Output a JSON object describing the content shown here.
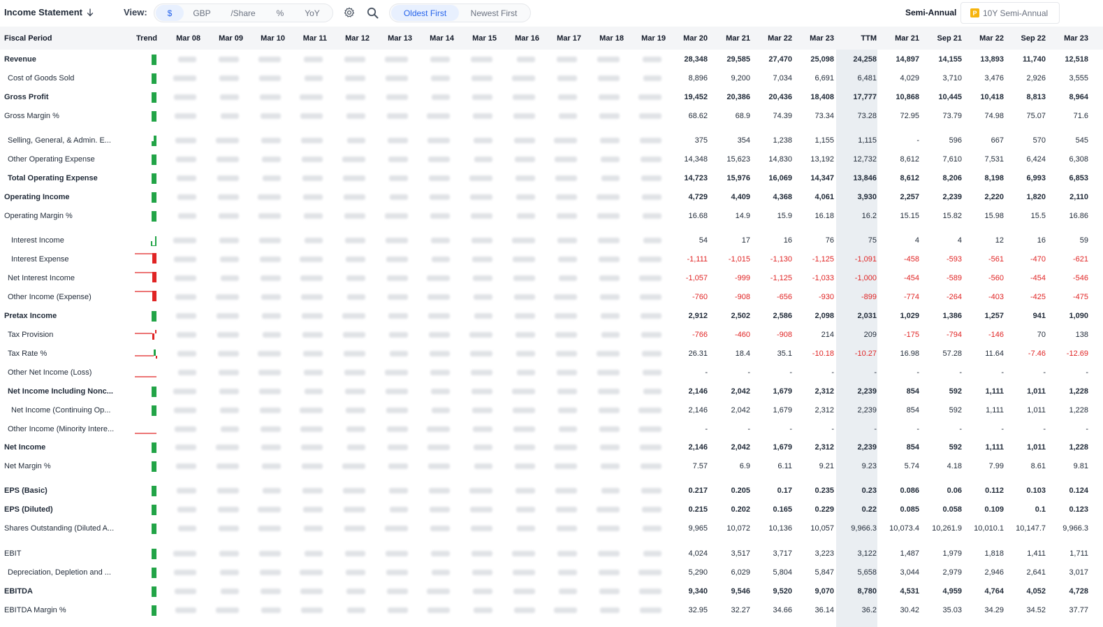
{
  "toolbar": {
    "title": "Income Statement",
    "view_label": "View:",
    "view_options": [
      "$",
      "GBP",
      "/Share",
      "%",
      "YoY"
    ],
    "order_options": [
      "Oldest First",
      "Newest First"
    ],
    "period_label": "Semi-Annual",
    "period_button": "10Y Semi-Annual",
    "period_badge": "P",
    "icons": [
      "settings-gear-icon",
      "search-icon",
      "sort-arrow-down-icon"
    ]
  },
  "table": {
    "label_header": "Fiscal Period",
    "trend_header": "Trend",
    "hidden_columns": [
      "Mar 08",
      "Mar 09",
      "Mar 10",
      "Mar 11",
      "Mar 12",
      "Mar 13",
      "Mar 14",
      "Mar 15",
      "Mar 16",
      "Mar 17",
      "Mar 18",
      "Mar 19"
    ],
    "visible_columns": [
      "Mar 20",
      "Mar 21",
      "Mar 22",
      "Mar 23",
      "TTM",
      "Mar 21",
      "Sep 21",
      "Mar 22",
      "Sep 22",
      "Mar 23"
    ],
    "colors": {
      "positive_trend": "#22a447",
      "negative_trend": "#e02424",
      "negative_value": "#e02424",
      "ttm_band": "#eaeef2"
    },
    "rows": [
      {
        "label": "Revenue",
        "bold": true,
        "indent": 0,
        "trend": "positive",
        "values": [
          "28,348",
          "29,585",
          "27,470",
          "25,098",
          "24,258",
          "14,897",
          "14,155",
          "13,893",
          "11,740",
          "12,518"
        ]
      },
      {
        "label": "Cost of Goods Sold",
        "bold": false,
        "indent": 1,
        "trend": "positive",
        "values": [
          "8,896",
          "9,200",
          "7,034",
          "6,691",
          "6,481",
          "4,029",
          "3,710",
          "3,476",
          "2,926",
          "3,555"
        ]
      },
      {
        "label": "Gross Profit",
        "bold": true,
        "indent": 0,
        "trend": "positive",
        "values": [
          "19,452",
          "20,386",
          "20,436",
          "18,408",
          "17,777",
          "10,868",
          "10,445",
          "10,418",
          "8,813",
          "8,964"
        ]
      },
      {
        "label": "Gross Margin %",
        "bold": false,
        "indent": 0,
        "trend": "positive",
        "values": [
          "68.62",
          "68.9",
          "74.39",
          "73.34",
          "73.28",
          "72.95",
          "73.79",
          "74.98",
          "75.07",
          "71.6"
        ]
      },
      {
        "label": "Selling, General, & Admin. E...",
        "bold": false,
        "indent": 1,
        "trend": "positive-step",
        "values": [
          "375",
          "354",
          "1,238",
          "1,155",
          "1,115",
          "-",
          "596",
          "667",
          "570",
          "545"
        ]
      },
      {
        "label": "Other Operating Expense",
        "bold": false,
        "indent": 1,
        "trend": "positive",
        "values": [
          "14,348",
          "15,623",
          "14,830",
          "13,192",
          "12,732",
          "8,612",
          "7,610",
          "7,531",
          "6,424",
          "6,308"
        ]
      },
      {
        "label": "Total Operating Expense",
        "bold": true,
        "indent": 1,
        "trend": "positive",
        "values": [
          "14,723",
          "15,976",
          "16,069",
          "14,347",
          "13,846",
          "8,612",
          "8,206",
          "8,198",
          "6,993",
          "6,853"
        ]
      },
      {
        "label": "Operating Income",
        "bold": true,
        "indent": 0,
        "trend": "positive",
        "values": [
          "4,729",
          "4,409",
          "4,368",
          "4,061",
          "3,930",
          "2,257",
          "2,239",
          "2,220",
          "1,820",
          "2,110"
        ]
      },
      {
        "label": "Operating Margin %",
        "bold": false,
        "indent": 0,
        "trend": "positive",
        "values": [
          "16.68",
          "14.9",
          "15.9",
          "16.18",
          "16.2",
          "15.15",
          "15.82",
          "15.98",
          "15.5",
          "16.86"
        ]
      },
      {
        "label": "Interest Income",
        "bold": false,
        "indent": 2,
        "trend": "positive-low",
        "values": [
          "54",
          "17",
          "16",
          "76",
          "75",
          "4",
          "4",
          "12",
          "16",
          "59"
        ]
      },
      {
        "label": "Interest Expense",
        "bold": false,
        "indent": 2,
        "trend": "negative",
        "values": [
          "-1,111",
          "-1,015",
          "-1,130",
          "-1,125",
          "-1,091",
          "-458",
          "-593",
          "-561",
          "-470",
          "-621"
        ]
      },
      {
        "label": "Net Interest Income",
        "bold": false,
        "indent": 1,
        "trend": "negative",
        "values": [
          "-1,057",
          "-999",
          "-1,125",
          "-1,033",
          "-1,000",
          "-454",
          "-589",
          "-560",
          "-454",
          "-546"
        ]
      },
      {
        "label": "Other Income (Expense)",
        "bold": false,
        "indent": 1,
        "trend": "negative",
        "values": [
          "-760",
          "-908",
          "-656",
          "-930",
          "-899",
          "-774",
          "-264",
          "-403",
          "-425",
          "-475"
        ]
      },
      {
        "label": "Pretax Income",
        "bold": true,
        "indent": 0,
        "trend": "positive",
        "values": [
          "2,912",
          "2,502",
          "2,586",
          "2,098",
          "2,031",
          "1,029",
          "1,386",
          "1,257",
          "941",
          "1,090"
        ]
      },
      {
        "label": "Tax Provision",
        "bold": false,
        "indent": 1,
        "trend": "negative-mixed",
        "values": [
          "-766",
          "-460",
          "-908",
          "214",
          "209",
          "-175",
          "-794",
          "-146",
          "70",
          "138"
        ]
      },
      {
        "label": "Tax Rate %",
        "bold": false,
        "indent": 1,
        "trend": "mixed",
        "values": [
          "26.31",
          "18.4",
          "35.1",
          "-10.18",
          "-10.27",
          "16.98",
          "57.28",
          "11.64",
          "-7.46",
          "-12.69"
        ]
      },
      {
        "label": "Other Net Income (Loss)",
        "bold": false,
        "indent": 1,
        "trend": "flat",
        "values": [
          "-",
          "-",
          "-",
          "-",
          "-",
          "-",
          "-",
          "-",
          "-",
          "-"
        ]
      },
      {
        "label": "Net Income Including Nonc...",
        "bold": true,
        "indent": 1,
        "trend": "positive",
        "values": [
          "2,146",
          "2,042",
          "1,679",
          "2,312",
          "2,239",
          "854",
          "592",
          "1,111",
          "1,011",
          "1,228"
        ]
      },
      {
        "label": "Net Income (Continuing Op...",
        "bold": false,
        "indent": 2,
        "trend": "positive",
        "values": [
          "2,146",
          "2,042",
          "1,679",
          "2,312",
          "2,239",
          "854",
          "592",
          "1,111",
          "1,011",
          "1,228"
        ]
      },
      {
        "label": "Other Income (Minority Intere...",
        "bold": false,
        "indent": 1,
        "trend": "flat",
        "values": [
          "-",
          "-",
          "-",
          "-",
          "-",
          "-",
          "-",
          "-",
          "-",
          "-"
        ]
      },
      {
        "label": "Net Income",
        "bold": true,
        "indent": 0,
        "trend": "positive",
        "values": [
          "2,146",
          "2,042",
          "1,679",
          "2,312",
          "2,239",
          "854",
          "592",
          "1,111",
          "1,011",
          "1,228"
        ]
      },
      {
        "label": "Net Margin %",
        "bold": false,
        "indent": 0,
        "trend": "positive",
        "values": [
          "7.57",
          "6.9",
          "6.11",
          "9.21",
          "9.23",
          "5.74",
          "4.18",
          "7.99",
          "8.61",
          "9.81"
        ]
      },
      {
        "label": "EPS (Basic)",
        "bold": true,
        "indent": 0,
        "trend": "positive",
        "values": [
          "0.217",
          "0.205",
          "0.17",
          "0.235",
          "0.23",
          "0.086",
          "0.06",
          "0.112",
          "0.103",
          "0.124"
        ]
      },
      {
        "label": "EPS (Diluted)",
        "bold": true,
        "indent": 0,
        "trend": "positive",
        "values": [
          "0.215",
          "0.202",
          "0.165",
          "0.229",
          "0.22",
          "0.085",
          "0.058",
          "0.109",
          "0.1",
          "0.123"
        ]
      },
      {
        "label": "Shares Outstanding (Diluted A...",
        "bold": false,
        "indent": 0,
        "trend": "positive",
        "values": [
          "9,965",
          "10,072",
          "10,136",
          "10,057",
          "9,966.3",
          "10,073.4",
          "10,261.9",
          "10,010.1",
          "10,147.7",
          "9,966.3"
        ]
      },
      {
        "label": "EBIT",
        "bold": false,
        "indent": 0,
        "trend": "positive",
        "values": [
          "4,024",
          "3,517",
          "3,717",
          "3,223",
          "3,122",
          "1,487",
          "1,979",
          "1,818",
          "1,411",
          "1,711"
        ]
      },
      {
        "label": "Depreciation, Depletion and ...",
        "bold": false,
        "indent": 1,
        "trend": "positive",
        "values": [
          "5,290",
          "6,029",
          "5,804",
          "5,847",
          "5,658",
          "3,044",
          "2,979",
          "2,946",
          "2,641",
          "3,017"
        ]
      },
      {
        "label": "EBITDA",
        "bold": true,
        "indent": 0,
        "trend": "positive",
        "values": [
          "9,340",
          "9,546",
          "9,520",
          "9,070",
          "8,780",
          "4,531",
          "4,959",
          "4,764",
          "4,052",
          "4,728"
        ]
      },
      {
        "label": "EBITDA Margin %",
        "bold": false,
        "indent": 0,
        "trend": "positive",
        "values": [
          "32.95",
          "32.27",
          "34.66",
          "36.14",
          "36.2",
          "30.42",
          "35.03",
          "34.29",
          "34.52",
          "37.77"
        ]
      }
    ]
  }
}
